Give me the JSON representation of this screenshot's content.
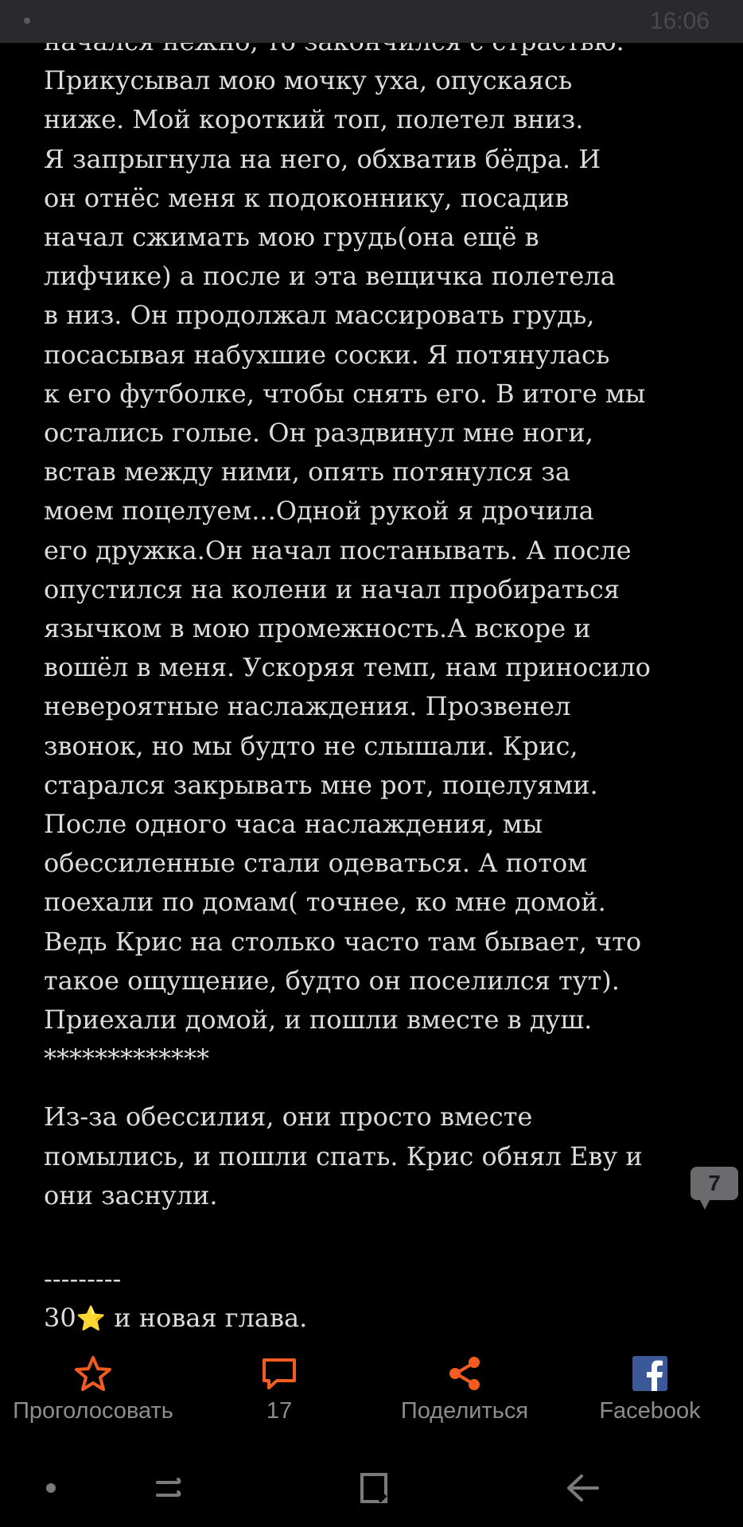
{
  "status_bar": {
    "time": "16:06"
  },
  "story": {
    "lines": [
      "начался нежно, то закончился с страстью.",
      "Прикусывал мою мочку уха, опускаясь",
      "ниже. Мой короткий топ, полетел вниз.",
      "Я запрыгнула на него, обхватив бёдра. И",
      "он отнёс меня к подоконнику, посадив",
      "начал сжимать мою грудь(она ещё в",
      "лифчике) а после и эта вещичка полетела",
      "в низ. Он продолжал массировать грудь,",
      "посасывая набухшие соски. Я потянулась",
      "к его футболке, чтобы снять его. В итоге мы",
      "остались голые. Он раздвинул мне ноги,",
      "встав между ними, опять потянулся за",
      "моем поцелуем...Одной рукой я дрочила",
      "его дружка.Он начал постанывать. А после",
      "опустился на колени и начал пробираться",
      "язычком в мою промежность.А вскоре и",
      "вошёл в меня. Ускоряя темп, нам приносило",
      "невероятные наслаждения. Прозвенел",
      "звонок, но мы будто не слышали. Крис,",
      "старался закрывать мне рот, поцелуями.",
      "После одного часа наслаждения, мы",
      "обессиленные стали одеваться. А потом",
      "поехали по домам( точнее, ко мне домой.",
      "Ведь Крис на столько часто там бывает, что",
      "такое ощущение, будто он поселился тут).",
      "Приехали домой, и пошли вместе в душ.",
      "*************"
    ],
    "lines2": [
      "Из-за обессилия, они просто вместе",
      "помылись, и пошли спать. Крис обнял Еву и",
      "они заснули."
    ],
    "divider": "---------",
    "footer_count": "30",
    "footer_star": "⭐",
    "footer_text": " и новая глава."
  },
  "comment_badge": {
    "count": "7"
  },
  "actions": {
    "vote_label": "Проголосовать",
    "comments_count": "17",
    "share_label": "Поделиться",
    "facebook_label": "Facebook"
  },
  "colors": {
    "accent": "#f25c1e",
    "facebook": "#3b5998",
    "text": "#dcdcdc",
    "muted": "#8d8d90"
  },
  "icons": {
    "vote": "star-outline-icon",
    "comments": "speech-bubble-icon",
    "share": "share-icon",
    "facebook": "facebook-logo-icon"
  }
}
